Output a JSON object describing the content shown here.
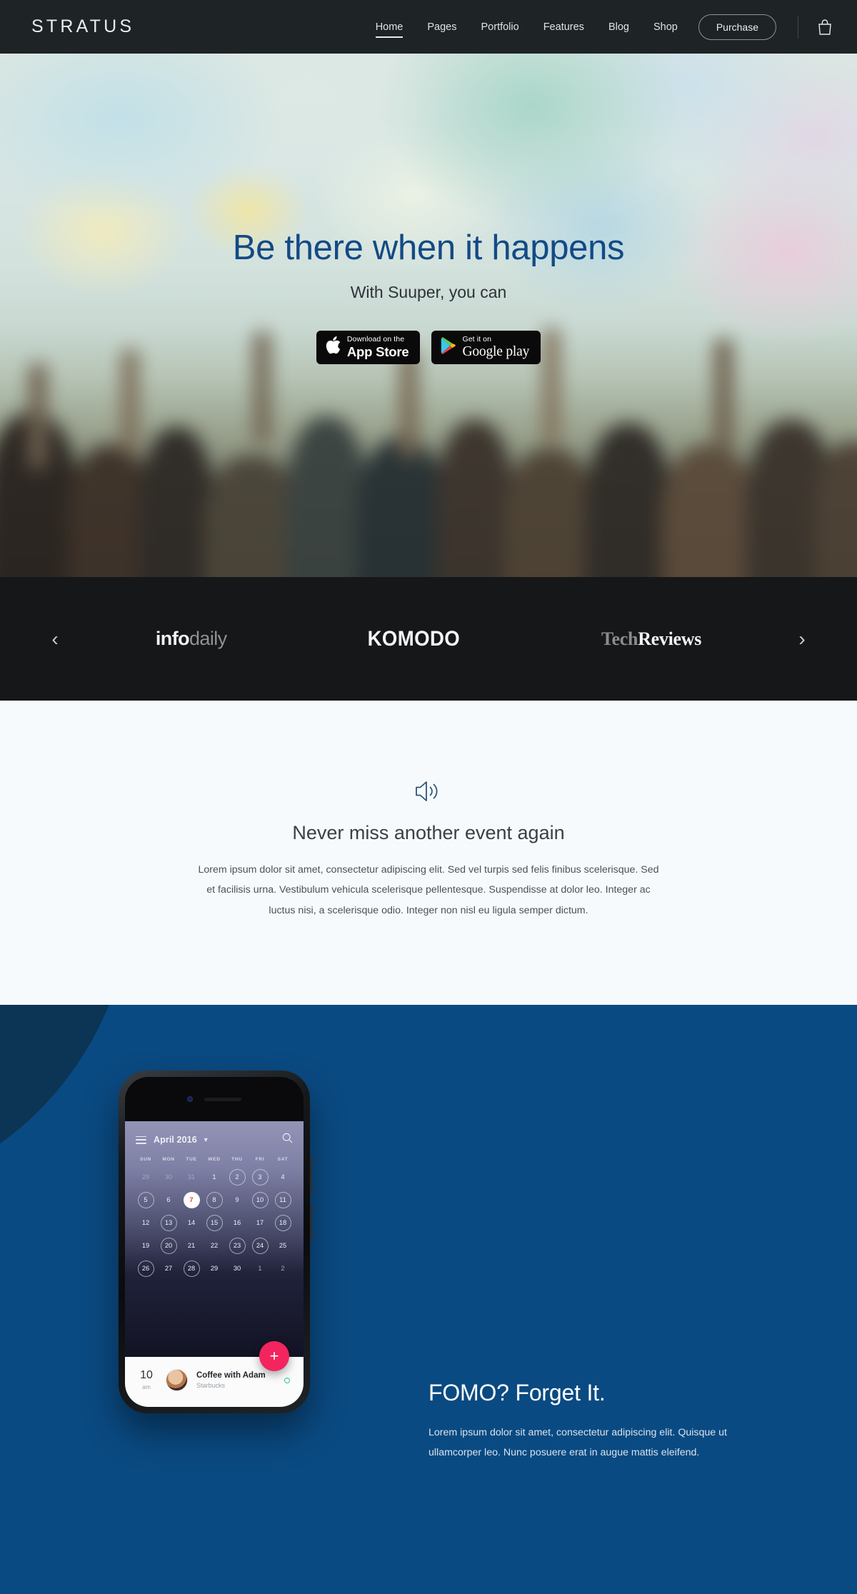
{
  "header": {
    "brand": "STRATUS",
    "nav_items": [
      {
        "label": "Home",
        "active": true
      },
      {
        "label": "Pages",
        "active": false
      },
      {
        "label": "Portfolio",
        "active": false
      },
      {
        "label": "Features",
        "active": false
      },
      {
        "label": "Blog",
        "active": false
      },
      {
        "label": "Shop",
        "active": false
      }
    ],
    "purchase_label": "Purchase",
    "cart_icon": "shopping-bag-icon",
    "background_color": "#1e2326"
  },
  "hero": {
    "title": "Be there when it happens",
    "subtitle": "With Suuper, you can",
    "title_color": "#134a85",
    "badges": [
      {
        "icon": "apple-icon",
        "small": "Download on the",
        "big": "App Store"
      },
      {
        "icon": "google-play-icon",
        "small": "Get it on",
        "big": "Google play"
      }
    ]
  },
  "logobar": {
    "prev_icon": "chevron-left-icon",
    "next_icon": "chevron-right-icon",
    "background_color": "#161719",
    "logos": [
      {
        "name": "infodaily",
        "bold_part": "info",
        "light_part": "daily"
      },
      {
        "name": "KOMODO",
        "text": "KOMODO"
      },
      {
        "name": "TechReviews",
        "gray_part": "Tech",
        "white_part": "Reviews"
      }
    ]
  },
  "feature": {
    "icon": "speaker-volume-icon",
    "title": "Never miss another event again",
    "body": "Lorem ipsum dolor sit amet, consectetur adipiscing elit. Sed vel turpis sed felis finibus scelerisque. Sed et facilisis urna. Vestibulum vehicula scelerisque pellentesque. Suspendisse at dolor leo. Integer ac luctus nisi, a scelerisque odio. Integer non nisl eu ligula semper dictum.",
    "background_color": "#f7fafd"
  },
  "promo": {
    "title": "FOMO? Forget It.",
    "body": "Lorem ipsum dolor sit amet, consectetur adipiscing elit. Quisque ut ullamcorper leo. Nunc posuere erat in augue mattis eleifend.",
    "background_color": "#0a4a82",
    "accent_color": "#0c3454"
  },
  "phone_app": {
    "menu_icon": "hamburger-menu-icon",
    "month_label": "April 2016",
    "dropdown_icon": "chevron-down-icon",
    "search_icon": "search-icon",
    "weekdays": [
      "SUN",
      "MON",
      "TUE",
      "WED",
      "THU",
      "FRI",
      "SAT"
    ],
    "weeks": [
      [
        {
          "n": "29",
          "muted": true,
          "ring": false,
          "today": false
        },
        {
          "n": "30",
          "muted": true,
          "ring": false,
          "today": false
        },
        {
          "n": "31",
          "muted": true,
          "ring": false,
          "today": false
        },
        {
          "n": "1",
          "muted": false,
          "ring": false,
          "today": false
        },
        {
          "n": "2",
          "muted": false,
          "ring": true,
          "today": false
        },
        {
          "n": "3",
          "muted": false,
          "ring": true,
          "today": false
        },
        {
          "n": "4",
          "muted": false,
          "ring": false,
          "today": false
        }
      ],
      [
        {
          "n": "5",
          "muted": false,
          "ring": true,
          "today": false
        },
        {
          "n": "6",
          "muted": false,
          "ring": false,
          "today": false
        },
        {
          "n": "7",
          "muted": false,
          "ring": false,
          "today": true
        },
        {
          "n": "8",
          "muted": false,
          "ring": true,
          "today": false
        },
        {
          "n": "9",
          "muted": false,
          "ring": false,
          "today": false
        },
        {
          "n": "10",
          "muted": false,
          "ring": true,
          "today": false
        },
        {
          "n": "11",
          "muted": false,
          "ring": true,
          "today": false
        }
      ],
      [
        {
          "n": "12",
          "muted": false,
          "ring": false,
          "today": false
        },
        {
          "n": "13",
          "muted": false,
          "ring": true,
          "today": false
        },
        {
          "n": "14",
          "muted": false,
          "ring": false,
          "today": false
        },
        {
          "n": "15",
          "muted": false,
          "ring": true,
          "today": false
        },
        {
          "n": "16",
          "muted": false,
          "ring": false,
          "today": false
        },
        {
          "n": "17",
          "muted": false,
          "ring": false,
          "today": false
        },
        {
          "n": "18",
          "muted": false,
          "ring": true,
          "today": false
        }
      ],
      [
        {
          "n": "19",
          "muted": false,
          "ring": false,
          "today": false
        },
        {
          "n": "20",
          "muted": false,
          "ring": true,
          "today": false
        },
        {
          "n": "21",
          "muted": false,
          "ring": false,
          "today": false
        },
        {
          "n": "22",
          "muted": false,
          "ring": false,
          "today": false
        },
        {
          "n": "23",
          "muted": false,
          "ring": true,
          "today": false
        },
        {
          "n": "24",
          "muted": false,
          "ring": true,
          "today": false
        },
        {
          "n": "25",
          "muted": false,
          "ring": false,
          "today": false
        }
      ],
      [
        {
          "n": "26",
          "muted": false,
          "ring": true,
          "today": false
        },
        {
          "n": "27",
          "muted": false,
          "ring": false,
          "today": false
        },
        {
          "n": "28",
          "muted": false,
          "ring": true,
          "today": false
        },
        {
          "n": "29",
          "muted": false,
          "ring": false,
          "today": false
        },
        {
          "n": "30",
          "muted": false,
          "ring": false,
          "today": false
        },
        {
          "n": "1",
          "muted": true,
          "ring": false,
          "today": false
        },
        {
          "n": "2",
          "muted": true,
          "ring": false,
          "today": false
        }
      ]
    ],
    "add_icon": "plus-icon",
    "add_button_color": "#f4245e",
    "today_text_color": "#d93a55",
    "event": {
      "time": "10",
      "meridiem": "am",
      "title": "Coffee with Adam",
      "location": "Starbucks",
      "status_icon": "status-dot-icon",
      "status_color": "#1ec9a0"
    }
  }
}
